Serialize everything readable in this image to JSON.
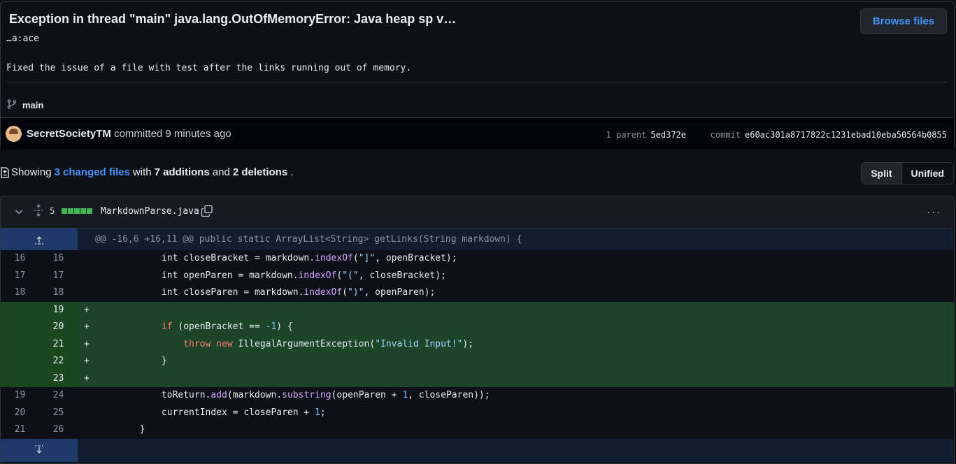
{
  "commit": {
    "title": "Exception in thread \"main\" java.lang.OutOfMemoryError: Java heap sp v…",
    "title_continuation": "…a:ace",
    "description": "Fixed the issue of a file with test after the links running out of memory.",
    "browse_files_label": "Browse files",
    "branch": "main",
    "author": "SecretSocietyTM",
    "action": "committed 9 minutes ago",
    "parent_label": "1 parent",
    "parent_sha": "5ed372e",
    "commit_label": "commit",
    "commit_sha": "e60ac301a8717822c1231ebad10eba50564b0855"
  },
  "summary": {
    "prefix": "Showing",
    "changed_files": "3 changed files",
    "with": "with",
    "additions": "7 additions",
    "and": "and",
    "deletions": "2 deletions",
    "suffix": "."
  },
  "view_toggle": {
    "split_label": "Split",
    "unified_label": "Unified",
    "selected": "Split"
  },
  "file": {
    "change_count": "5",
    "name": "MarkdownParse.java",
    "hunk_header": "@@ -16,6 +16,11 @@ public static ArrayList<String> getLinks(String markdown) {"
  },
  "lines": [
    {
      "old": "16",
      "new": "16",
      "type": "context",
      "sign": "",
      "indent": "            ",
      "parts": [
        [
          "",
          "int closeBracket = markdown."
        ],
        [
          "f",
          "indexOf"
        ],
        [
          "",
          "("
        ],
        [
          "s",
          "\"]\""
        ],
        [
          "",
          ", openBracket);"
        ]
      ]
    },
    {
      "old": "17",
      "new": "17",
      "type": "context",
      "sign": "",
      "indent": "            ",
      "parts": [
        [
          "",
          "int openParen = markdown."
        ],
        [
          "f",
          "indexOf"
        ],
        [
          "",
          "("
        ],
        [
          "s",
          "\"(\""
        ],
        [
          "",
          ", closeBracket);"
        ]
      ]
    },
    {
      "old": "18",
      "new": "18",
      "type": "context",
      "sign": "",
      "indent": "            ",
      "parts": [
        [
          "",
          "int closeParen = markdown."
        ],
        [
          "f",
          "indexOf"
        ],
        [
          "",
          "("
        ],
        [
          "s",
          "\")\""
        ],
        [
          "",
          ", openParen);"
        ]
      ]
    },
    {
      "old": "",
      "new": "19",
      "type": "add",
      "sign": "+",
      "indent": "",
      "parts": []
    },
    {
      "old": "",
      "new": "20",
      "type": "add",
      "sign": "+",
      "indent": "            ",
      "parts": [
        [
          "k",
          "if"
        ],
        [
          "",
          " (openBracket == "
        ],
        [
          "n",
          "-1"
        ],
        [
          "",
          ") {"
        ]
      ]
    },
    {
      "old": "",
      "new": "21",
      "type": "add",
      "sign": "+",
      "indent": "                ",
      "parts": [
        [
          "k",
          "throw"
        ],
        [
          "",
          " "
        ],
        [
          "k",
          "new"
        ],
        [
          "",
          " IllegalArgumentException("
        ],
        [
          "s",
          "\"Invalid Input!\""
        ],
        [
          "",
          ");"
        ]
      ]
    },
    {
      "old": "",
      "new": "22",
      "type": "add",
      "sign": "+",
      "indent": "            ",
      "parts": [
        [
          "",
          "}"
        ]
      ]
    },
    {
      "old": "",
      "new": "23",
      "type": "add",
      "sign": "+",
      "indent": "",
      "parts": []
    },
    {
      "old": "19",
      "new": "24",
      "type": "context",
      "sign": "",
      "indent": "            ",
      "parts": [
        [
          "",
          "toReturn."
        ],
        [
          "f",
          "add"
        ],
        [
          "",
          "(markdown."
        ],
        [
          "f",
          "substring"
        ],
        [
          "",
          "(openParen + "
        ],
        [
          "n",
          "1"
        ],
        [
          "",
          ", closeParen));"
        ]
      ]
    },
    {
      "old": "20",
      "new": "25",
      "type": "context",
      "sign": "",
      "indent": "            ",
      "parts": [
        [
          "",
          "currentIndex = closeParen + "
        ],
        [
          "n",
          "1"
        ],
        [
          "",
          ";"
        ]
      ]
    },
    {
      "old": "21",
      "new": "26",
      "type": "context",
      "sign": "",
      "indent": "        ",
      "parts": [
        [
          "",
          "}"
        ]
      ]
    }
  ],
  "icons": {
    "branch": "git-branch-icon",
    "file_toggle": "chevron-down-icon",
    "expand": "unfold-icon",
    "copy": "copy-icon",
    "more": "kebab-horizontal-icon",
    "expand_up": "expand-up-icon",
    "expand_down": "expand-down-icon",
    "diff_file": "file-diff-icon"
  }
}
